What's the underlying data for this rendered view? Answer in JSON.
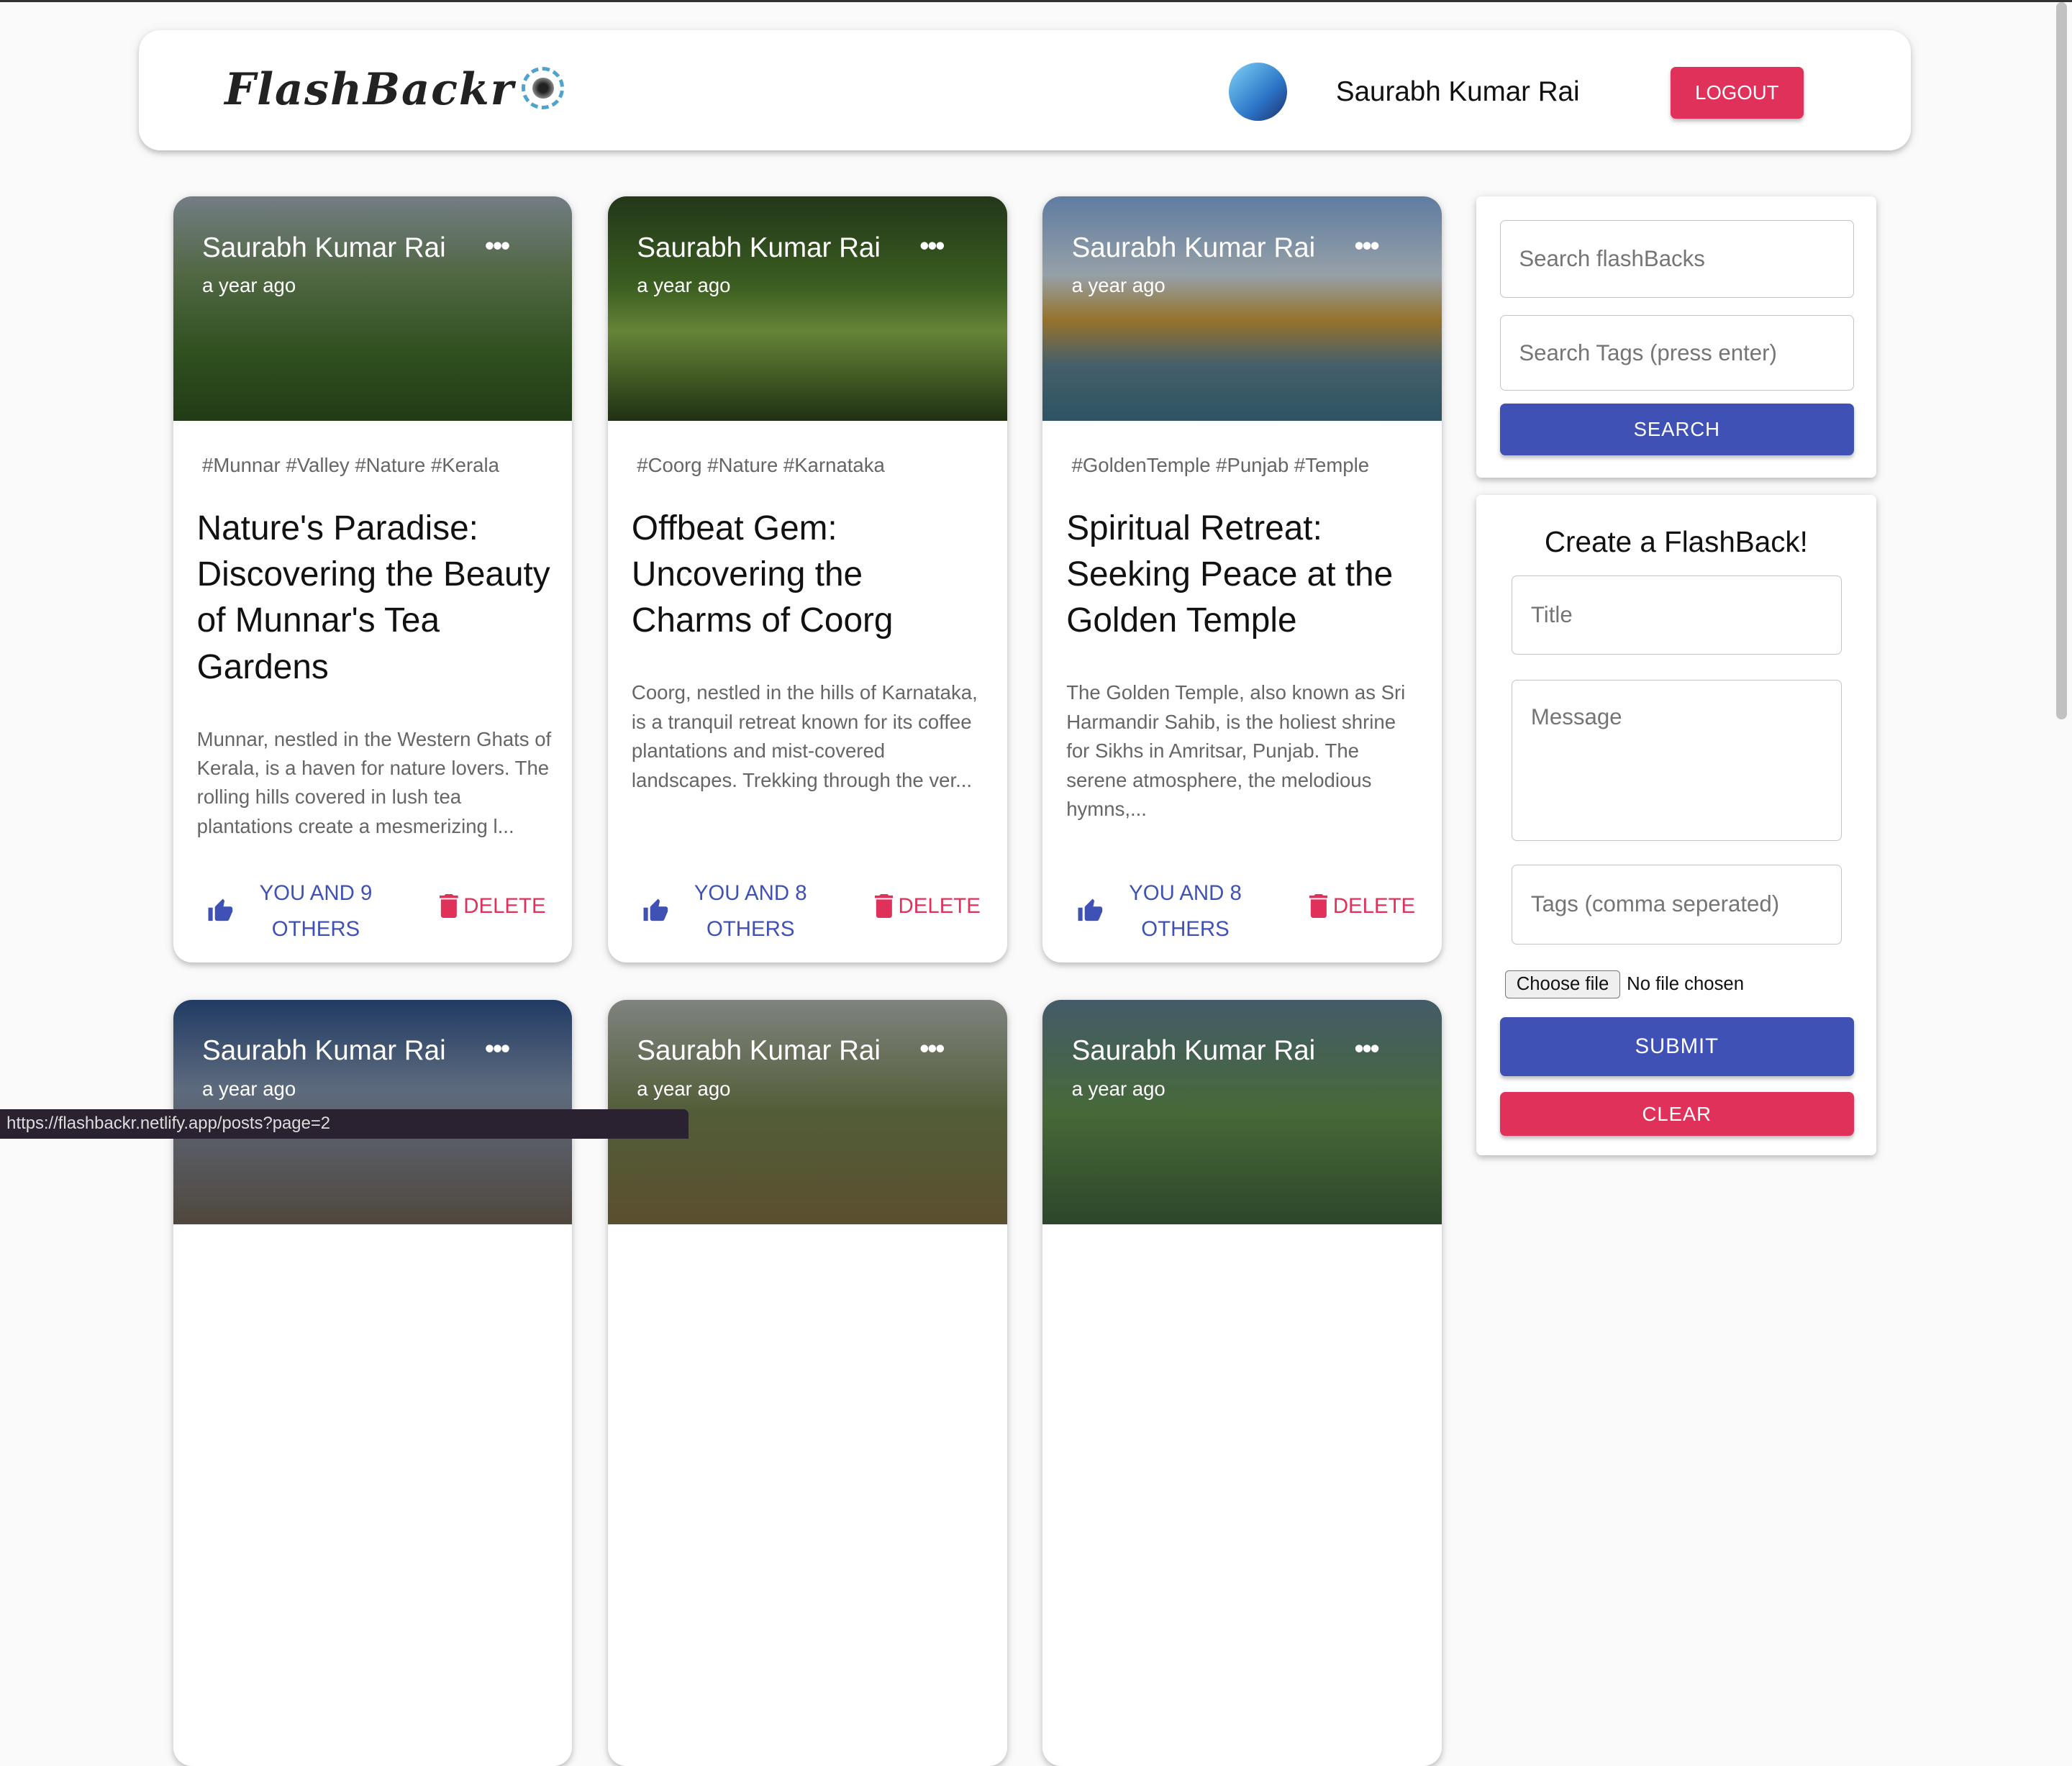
{
  "header": {
    "logo": "FlashBackr",
    "user_name": "Saurabh Kumar Rai",
    "logout_label": "LOGOUT"
  },
  "posts": [
    {
      "author": "Saurabh Kumar Rai",
      "time": "a year ago",
      "tags": "#Munnar #Valley #Nature #Kerala",
      "title": "Nature's Paradise: Discovering the Beauty of Munnar's Tea Gardens",
      "message": "Munnar, nestled in the Western Ghats of Kerala, is a haven for nature lovers. The rolling hills covered in lush tea plantations create a mesmerizing l...",
      "likes": "YOU AND 9 OTHERS",
      "delete": "DELETE"
    },
    {
      "author": "Saurabh Kumar Rai",
      "time": "a year ago",
      "tags": "#Coorg #Nature #Karnataka",
      "title": "Offbeat Gem: Uncovering the Charms of Coorg",
      "message": "Coorg, nestled in the hills of Karnataka, is a tranquil retreat known for its coffee plantations and mist-covered landscapes. Trekking through the ver...",
      "likes": "YOU AND 8 OTHERS",
      "delete": "DELETE"
    },
    {
      "author": "Saurabh Kumar Rai",
      "time": "a year ago",
      "tags": "#GoldenTemple #Punjab #Temple",
      "title": "Spiritual Retreat: Seeking Peace at the Golden Temple",
      "message": "The Golden Temple, also known as Sri Harmandir Sahib, is the holiest shrine for Sikhs in Amritsar, Punjab. The serene atmosphere, the melodious hymns,...",
      "likes": "YOU AND 8 OTHERS",
      "delete": "DELETE"
    },
    {
      "author": "Saurabh Kumar Rai",
      "time": "a year ago"
    },
    {
      "author": "Saurabh Kumar Rai",
      "time": "a year ago"
    },
    {
      "author": "Saurabh Kumar Rai",
      "time": "a year ago"
    }
  ],
  "search": {
    "search_placeholder": "Search flashBacks",
    "tags_placeholder": "Search Tags (press enter)",
    "button": "SEARCH"
  },
  "form": {
    "heading": "Create a FlashBack!",
    "title_placeholder": "Title",
    "message_placeholder": "Message",
    "tags_placeholder": "Tags (comma seperated)",
    "choose_file": "Choose file",
    "no_file": "No file chosen",
    "submit": "SUBMIT",
    "clear": "CLEAR"
  },
  "status_url": "https://flashbackr.netlify.app/posts?page=2",
  "colors": {
    "primary": "#3f51b5",
    "secondary": "#e0315b"
  }
}
